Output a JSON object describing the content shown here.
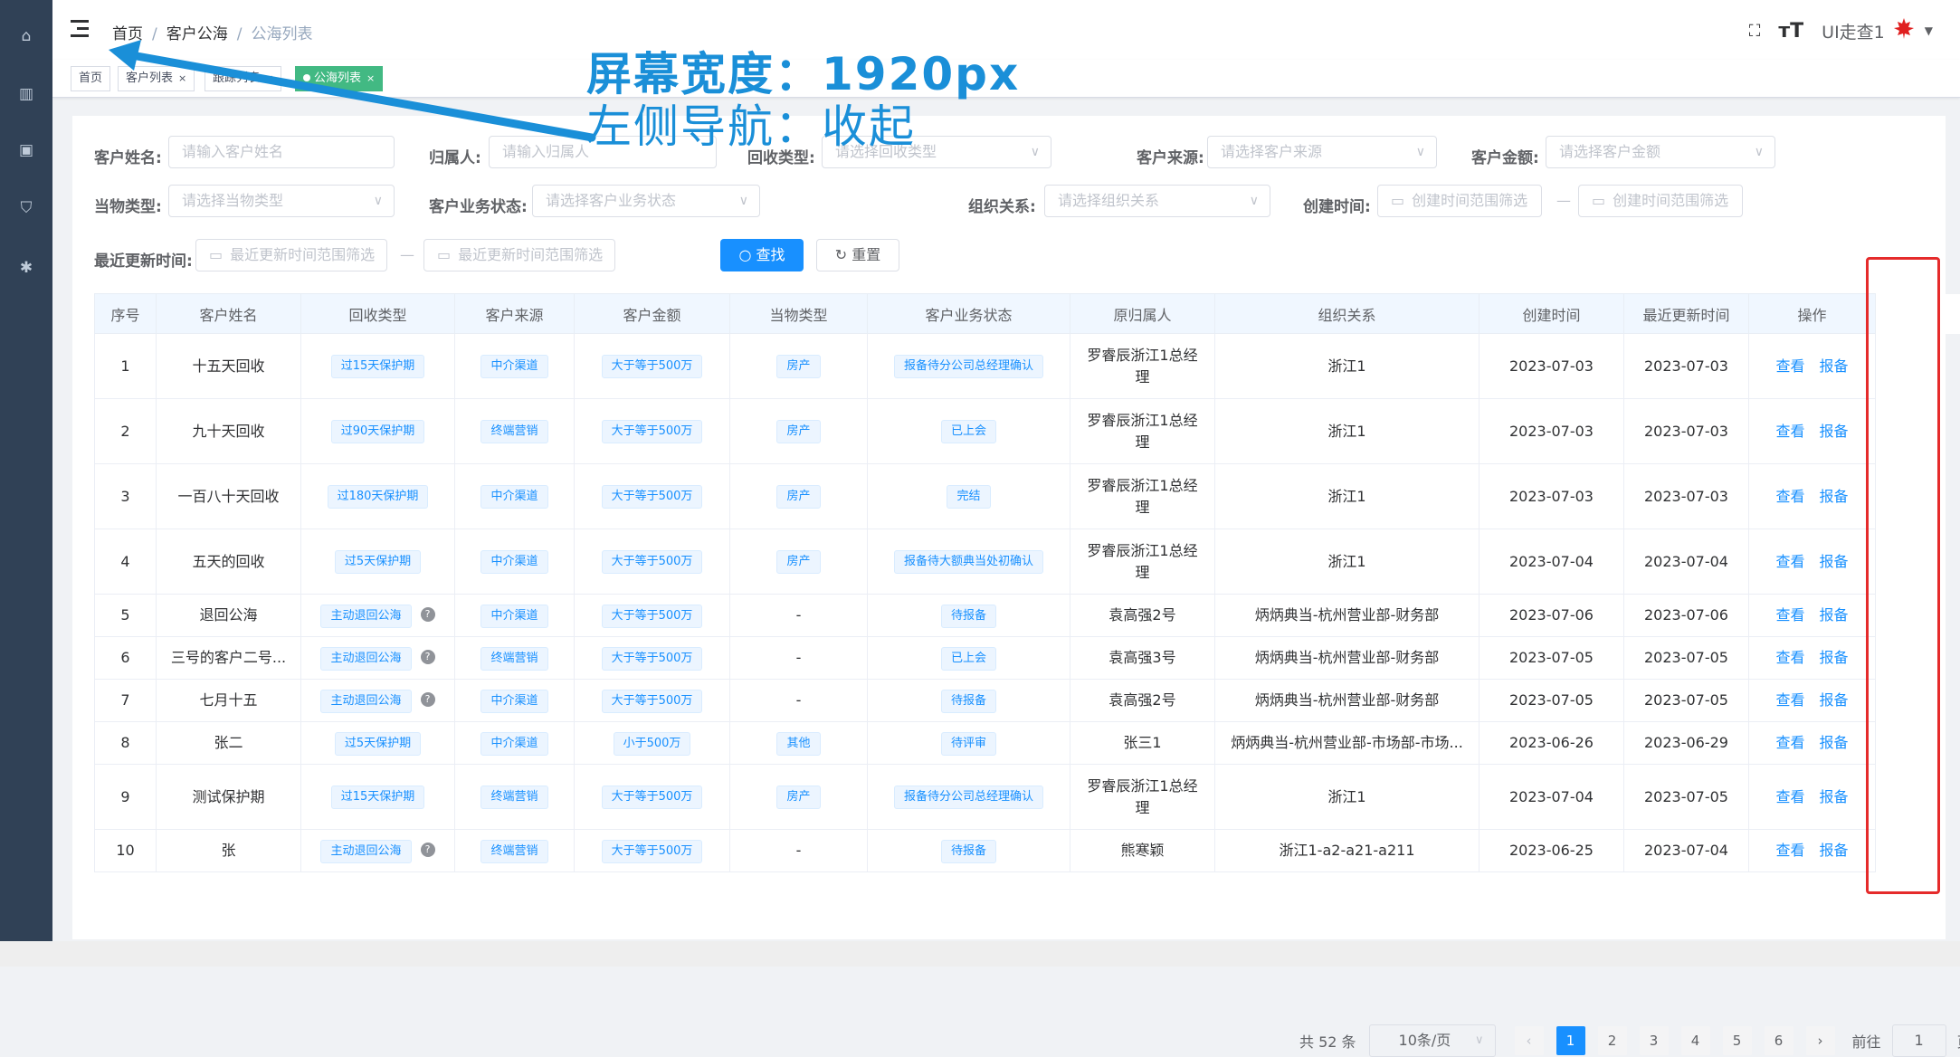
{
  "navbar": {
    "breadcrumb": [
      "首页",
      "客户公海",
      "公海列表"
    ],
    "user_name": "UI走查1"
  },
  "tags": [
    {
      "label": "首页",
      "active": false
    },
    {
      "label": "客户列表",
      "active": false
    },
    {
      "label": "跟踪列表",
      "active": false
    },
    {
      "label": "公海列表",
      "active": true
    }
  ],
  "annotation": {
    "line1": "屏幕宽度：1920px",
    "line2": "左侧导航：收起"
  },
  "filters": {
    "name_label": "客户姓名:",
    "name_placeholder": "请输入客户姓名",
    "owner_label": "归属人:",
    "owner_placeholder": "请输入归属人",
    "recycle_label": "回收类型:",
    "recycle_placeholder": "请选择回收类型",
    "source_label": "客户来源:",
    "source_placeholder": "请选择客户来源",
    "amount_label": "客户金额:",
    "amount_placeholder": "请选择客户金额",
    "pawn_label": "当物类型:",
    "pawn_placeholder": "请选择当物类型",
    "status_label": "客户业务状态:",
    "status_placeholder": "请选择客户业务状态",
    "org_label": "组织关系:",
    "org_placeholder": "请选择组织关系",
    "created_label": "创建时间:",
    "created_placeholder": "创建时间范围筛选",
    "updated_label": "最近更新时间:",
    "updated_placeholder": "最近更新时间范围筛选",
    "range_sep": "—",
    "search_label": "查找",
    "reset_label": "重置"
  },
  "table": {
    "headers": [
      "序号",
      "客户姓名",
      "回收类型",
      "客户来源",
      "客户金额",
      "当物类型",
      "客户业务状态",
      "原归属人",
      "组织关系",
      "创建时间",
      "最近更新时间",
      "操作"
    ],
    "view_label": "查看",
    "report_label": "报备",
    "rows": [
      {
        "no": "1",
        "name": "十五天回收",
        "recycle": "过15天保护期",
        "help": false,
        "source": "中介渠道",
        "amount": "大于等于500万",
        "pawn": "房产",
        "pawn_badge": true,
        "status": "报备待分公司总经理确认",
        "owner": "罗睿辰浙江1总经理",
        "org": "浙江1",
        "created": "2023-07-03",
        "updated": "2023-07-03"
      },
      {
        "no": "2",
        "name": "九十天回收",
        "recycle": "过90天保护期",
        "help": false,
        "source": "终端营销",
        "amount": "大于等于500万",
        "pawn": "房产",
        "pawn_badge": true,
        "status": "已上会",
        "owner": "罗睿辰浙江1总经理",
        "org": "浙江1",
        "created": "2023-07-03",
        "updated": "2023-07-03"
      },
      {
        "no": "3",
        "name": "一百八十天回收",
        "recycle": "过180天保护期",
        "help": false,
        "source": "中介渠道",
        "amount": "大于等于500万",
        "pawn": "房产",
        "pawn_badge": true,
        "status": "完结",
        "owner": "罗睿辰浙江1总经理",
        "org": "浙江1",
        "created": "2023-07-03",
        "updated": "2023-07-03"
      },
      {
        "no": "4",
        "name": "五天的回收",
        "recycle": "过5天保护期",
        "help": false,
        "source": "中介渠道",
        "amount": "大于等于500万",
        "pawn": "房产",
        "pawn_badge": true,
        "status": "报备待大额典当处初确认",
        "owner": "罗睿辰浙江1总经理",
        "org": "浙江1",
        "created": "2023-07-04",
        "updated": "2023-07-04"
      },
      {
        "no": "5",
        "name": "退回公海",
        "recycle": "主动退回公海",
        "help": true,
        "source": "中介渠道",
        "amount": "大于等于500万",
        "pawn": "-",
        "pawn_badge": false,
        "status": "待报备",
        "owner": "袁高强2号",
        "org": "炳炳典当-杭州营业部-财务部",
        "created": "2023-07-06",
        "updated": "2023-07-06"
      },
      {
        "no": "6",
        "name": "三号的客户二号...",
        "recycle": "主动退回公海",
        "help": true,
        "source": "终端营销",
        "amount": "大于等于500万",
        "pawn": "-",
        "pawn_badge": false,
        "status": "已上会",
        "owner": "袁高强3号",
        "org": "炳炳典当-杭州营业部-财务部",
        "created": "2023-07-05",
        "updated": "2023-07-05"
      },
      {
        "no": "7",
        "name": "七月十五",
        "recycle": "主动退回公海",
        "help": true,
        "source": "中介渠道",
        "amount": "大于等于500万",
        "pawn": "-",
        "pawn_badge": false,
        "status": "待报备",
        "owner": "袁高强2号",
        "org": "炳炳典当-杭州营业部-财务部",
        "created": "2023-07-05",
        "updated": "2023-07-05"
      },
      {
        "no": "8",
        "name": "张二",
        "recycle": "过5天保护期",
        "help": false,
        "source": "中介渠道",
        "amount": "小于500万",
        "pawn": "其他",
        "pawn_badge": true,
        "status": "待评审",
        "owner": "张三1",
        "org": "炳炳典当-杭州营业部-市场部-市场...",
        "created": "2023-06-26",
        "updated": "2023-06-29"
      },
      {
        "no": "9",
        "name": "测试保护期",
        "recycle": "过15天保护期",
        "help": false,
        "source": "终端营销",
        "amount": "大于等于500万",
        "pawn": "房产",
        "pawn_badge": true,
        "status": "报备待分公司总经理确认",
        "owner": "罗睿辰浙江1总经理",
        "org": "浙江1",
        "created": "2023-07-04",
        "updated": "2023-07-05"
      },
      {
        "no": "10",
        "name": "张",
        "recycle": "主动退回公海",
        "help": true,
        "source": "终端营销",
        "amount": "大于等于500万",
        "pawn": "-",
        "pawn_badge": false,
        "status": "待报备",
        "owner": "熊寒颖",
        "org": "浙江1-a2-a21-a211",
        "created": "2023-06-25",
        "updated": "2023-07-04"
      }
    ]
  },
  "pagination": {
    "total": "共 52 条",
    "page_size": "10条/页",
    "pages": [
      "1",
      "2",
      "3",
      "4",
      "5",
      "6"
    ],
    "goto_label": "前往",
    "goto_value": "1",
    "page_unit": "页"
  }
}
